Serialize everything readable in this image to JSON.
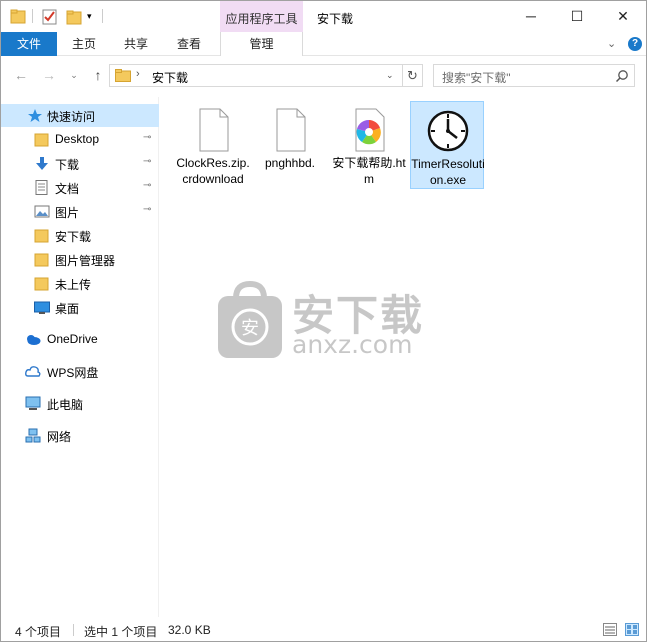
{
  "titlebar": {
    "title": "安下载",
    "context_tab_group": "应用程序工具",
    "quick_access": [
      "folder-icon",
      "properties-check-icon",
      "new-folder-icon",
      "customize-dropdown-icon"
    ],
    "controls": {
      "minimize": "─",
      "maximize": "☐",
      "close": "✕"
    }
  },
  "ribbon": {
    "tabs": [
      {
        "label": "文件",
        "active": true
      },
      {
        "label": "主页"
      },
      {
        "label": "共享"
      },
      {
        "label": "查看"
      },
      {
        "label": "管理"
      }
    ],
    "expand_glyph": "⌄",
    "help_glyph": "?"
  },
  "navbar": {
    "back": "←",
    "forward": "→",
    "recent": "⌄",
    "up": "↑",
    "path_sep": "›",
    "path": "安下载",
    "dropdown": "⌄",
    "refresh": "↻",
    "search_placeholder": "搜索\"安下载\""
  },
  "sidebar": {
    "items": [
      {
        "label": "快速访问",
        "icon": "star-icon",
        "pinned": false,
        "selected": true
      },
      {
        "label": "Desktop",
        "icon": "folder-icon",
        "pinned": true
      },
      {
        "label": "下载",
        "icon": "download-arrow-icon",
        "pinned": true
      },
      {
        "label": "文档",
        "icon": "document-icon",
        "pinned": true
      },
      {
        "label": "图片",
        "icon": "pictures-icon",
        "pinned": true
      },
      {
        "label": "安下载",
        "icon": "folder-icon",
        "pinned": false
      },
      {
        "label": "图片管理器",
        "icon": "folder-icon",
        "pinned": false
      },
      {
        "label": "未上传",
        "icon": "folder-icon",
        "pinned": false
      },
      {
        "label": "桌面",
        "icon": "desktop-icon",
        "pinned": false
      },
      {
        "label": "OneDrive",
        "icon": "cloud-icon",
        "pinned": false
      },
      {
        "label": "WPS网盘",
        "icon": "wps-cloud-icon",
        "pinned": false
      },
      {
        "label": "此电脑",
        "icon": "computer-icon",
        "pinned": false
      },
      {
        "label": "网络",
        "icon": "network-icon",
        "pinned": false
      }
    ],
    "pin_glyph": "📌"
  },
  "files": [
    {
      "name": "ClockRes.zip.crdownload",
      "display": "ClockRes.zip.crdownload",
      "icon": "blank-file-icon",
      "selected": false
    },
    {
      "name": "pnghhbd.",
      "display": "pnghhbd.",
      "icon": "blank-file-icon",
      "selected": false
    },
    {
      "name": "安下载帮助.htm",
      "display": "安下载帮助.htm",
      "icon": "browser-htm-icon",
      "selected": false
    },
    {
      "name": "TimerResolution.exe",
      "display": "TimerResolution.exe",
      "icon": "clock-exe-icon",
      "selected": true
    }
  ],
  "watermark": {
    "cn": "安下载",
    "en": "anxz.com",
    "logo_char": "安"
  },
  "statusbar": {
    "count": "4 个项目",
    "selected": "选中 1 个项目",
    "size": "32.0 KB"
  },
  "colors": {
    "accent": "#1979ca",
    "selection": "#cce8ff",
    "context_tab": "#f1dcf4",
    "folder": "#f4c95d"
  }
}
